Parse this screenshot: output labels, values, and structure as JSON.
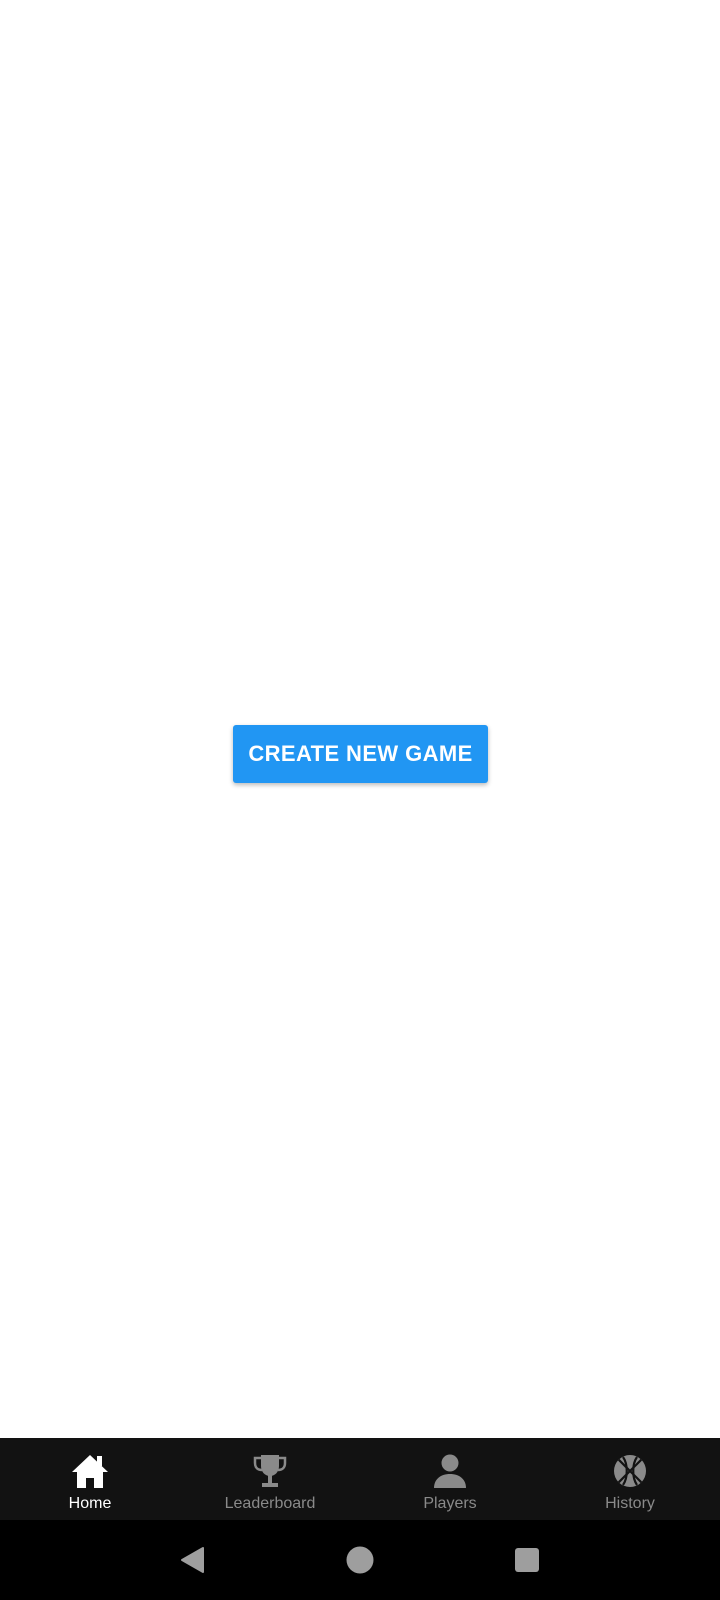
{
  "main": {
    "create_button_label": "CREATE NEW GAME"
  },
  "bottom_nav": {
    "active_index": 0,
    "items": [
      {
        "label": "Home",
        "icon": "home-icon"
      },
      {
        "label": "Leaderboard",
        "icon": "trophy-icon"
      },
      {
        "label": "Players",
        "icon": "person-icon"
      },
      {
        "label": "History",
        "icon": "basketball-icon"
      }
    ]
  },
  "system_nav": {
    "buttons": [
      "back-icon",
      "home-circle-icon",
      "recents-icon"
    ]
  },
  "colors": {
    "primary": "#2196f3",
    "nav_background": "#121212",
    "nav_active": "#ffffff",
    "nav_inactive": "#8a8a8a",
    "system_bar": "#000000"
  }
}
